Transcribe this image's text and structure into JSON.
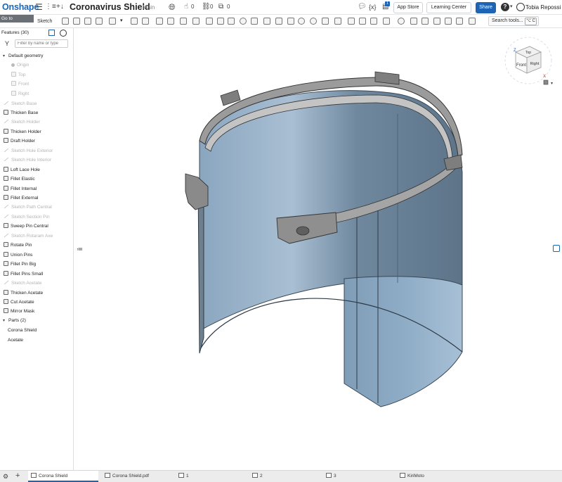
{
  "app": {
    "logo": "Onshape"
  },
  "document": {
    "title": "Coronavirus Shield",
    "branch": "Main"
  },
  "counts": {
    "likes": "0",
    "links": "0",
    "copies": "0"
  },
  "header_buttons": {
    "app_store": "App Store",
    "learning_center": "Learning Center",
    "share": "Share",
    "help": "?",
    "user": "Tobia Repossi"
  },
  "notification_badge": "1",
  "tooltip": "Go to documents",
  "toolbar": {
    "sketch_label": "Sketch",
    "search_placeholder": "Search tools...",
    "search_shortcut": "⌥ C"
  },
  "panel": {
    "header": "Features (30)",
    "filter_placeholder": "Filter by name or type",
    "default_geometry": "Default geometry",
    "default_items": [
      "Origin",
      "Top",
      "Front",
      "Right"
    ],
    "features": [
      "Sketch Base",
      "Thicken Base",
      "Sketch Holder",
      "Thicken Holder",
      "Draft Holder",
      "Sketch Hole Exterior",
      "Sketch Hole Interior",
      "Loft Lace Hole",
      "Fillet Elastic",
      "Fillet Internal",
      "Fillet External",
      "Sketch Path Central",
      "Sketch Section Pin",
      "Sweep Pin Central",
      "Sketch Rotaram Axe",
      "Rotate Pin",
      "Union Pins",
      "Fillet Pin Big",
      "Fillet Pins Small",
      "Sketch Acetate",
      "Thicken Acetate",
      "Cut Acetate",
      "Mirror Mask"
    ],
    "parts_header": "Parts (2)",
    "parts": [
      "Corona Shield",
      "Acetate"
    ]
  },
  "viewcube": {
    "top": "Top",
    "front": "Front",
    "right": "Right",
    "axis_z": "Z",
    "axis_x": "X"
  },
  "bottom_tabs": [
    "Corona Shield",
    "Corona Shield.pdf",
    "1",
    "2",
    "3",
    "KiriMoto"
  ],
  "colors": {
    "brand": "#1b66b3",
    "share": "#1f63b5",
    "acetate": "#7f9fba",
    "holder": "#8a8a8a"
  }
}
